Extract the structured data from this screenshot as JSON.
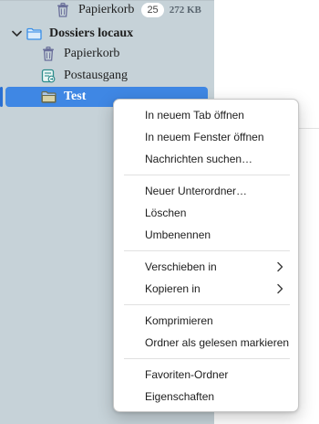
{
  "tree": {
    "trash_top": {
      "label": "Papierkorb",
      "count": "25",
      "size": "272 KB",
      "icon": "trash-icon"
    },
    "account": {
      "label": "Dossiers locaux",
      "icon": "folder-icon",
      "twisty": "chevron-down-icon"
    },
    "trash": {
      "label": "Papierkorb",
      "icon": "trash-icon"
    },
    "outbox": {
      "label": "Postausgang",
      "icon": "outbox-icon"
    },
    "test": {
      "label": "Test",
      "icon": "folder-icon"
    }
  },
  "menu": {
    "items": [
      {
        "label": "In neuem Tab öffnen"
      },
      {
        "label": "In neuem Fenster öffnen"
      },
      {
        "label": "Nachrichten suchen…"
      },
      {
        "label": "Neuer Unterordner…"
      },
      {
        "label": "Löschen"
      },
      {
        "label": "Umbenennen"
      },
      {
        "label": "Verschieben in",
        "submenu": true
      },
      {
        "label": "Kopieren in",
        "submenu": true
      },
      {
        "label": "Komprimieren"
      },
      {
        "label": "Ordner als gelesen markieren"
      },
      {
        "label": "Favoriten-Ordner"
      },
      {
        "label": "Eigenschaften"
      }
    ]
  },
  "colors": {
    "sidebar": "#c6d2d8",
    "selection": "#3f87e4",
    "folder_blue": "#3a8ee6",
    "outbox_teal": "#2e8c8c"
  }
}
